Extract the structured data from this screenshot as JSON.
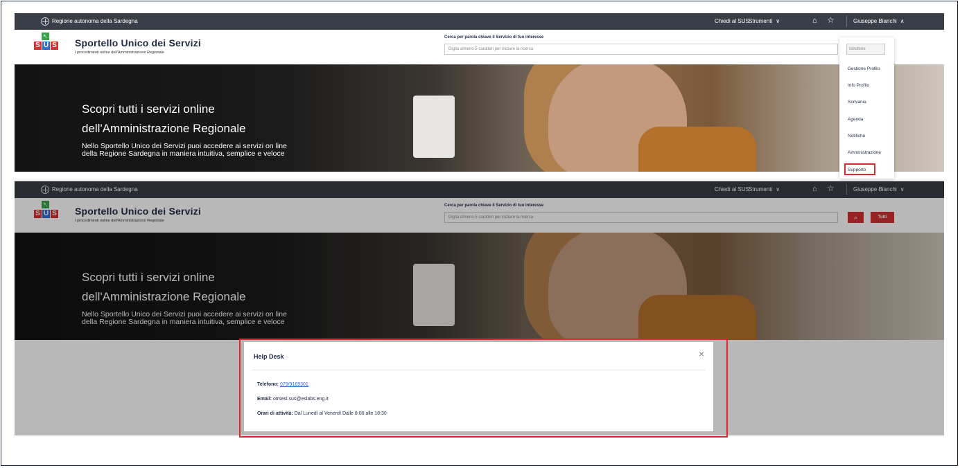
{
  "top_bar": {
    "region_label": "Regione autonoma della Sardegna",
    "chiedi_label": "Chiedi al SUS",
    "strumenti_label": "Strumenti",
    "user_name": "Giuseppe Bianchi",
    "chevron_up": "∧",
    "chevron_down": "∨",
    "bell_glyph": "⌂",
    "star_glyph": "☆"
  },
  "logo": {
    "arrow_glyph": "↖",
    "letters": [
      "S",
      "U",
      "S"
    ],
    "colors": {
      "S": "#d3302f",
      "U": "#2f6fd1",
      "arrow": "#3aa34a"
    }
  },
  "site": {
    "title": "Sportello Unico dei Servizi",
    "subtitle": "I procedimenti online dell'Amministrazione Regionale"
  },
  "search": {
    "label": "Cerca per parola chiave il Servizio di tuo interesse",
    "placeholder": "Digita almeno 5 caratteri per iniziare la ricerca",
    "search_icon": "⌕",
    "tutti_label": "Tutti"
  },
  "hero": {
    "line1": "Scopri tutti i servizi online",
    "line2": "dell'Amministrazione Regionale",
    "line3": "Nello Sportello Unico dei Servizi puoi accedere ai servizi on line",
    "line4": "della Regione Sardegna in maniera intuitiva, semplice e veloce"
  },
  "user_menu": {
    "role": "Istruttore",
    "items": [
      "Gestione Profilo",
      "Info Profilo",
      "Scrivania",
      "Agenda",
      "Notifiche",
      "Amministrazione",
      "Supporto"
    ],
    "highlighted_item": "Supporto"
  },
  "help_desk": {
    "title": "Help Desk",
    "close_glyph": "×",
    "phone_label": "Telefono:",
    "phone_value": "079/9169301",
    "email_label": "Email:",
    "email_value": "otrsesl.sus@eslabs.eng.it",
    "hours_label": "Orari di attività:",
    "hours_value": "Dal Lunedì al Venerdì Dalle 8:00 alle 18:30"
  },
  "accent_colors": {
    "red": "#d3302f",
    "highlight_red": "#e0262f",
    "dark_bar": "#3a3f47",
    "link_blue": "#2f6fd1",
    "navy": "#1f2a44"
  }
}
